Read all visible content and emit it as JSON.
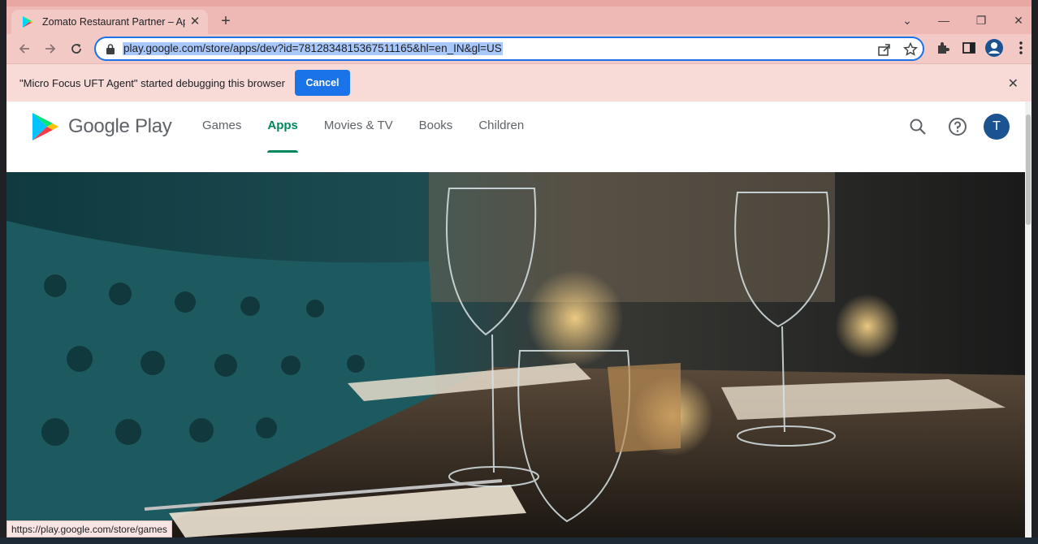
{
  "browser": {
    "tab_title": "Zomato Restaurant Partner – App",
    "new_tab_label": "+",
    "url": "play.google.com/store/apps/dev?id=7812834815367511165&hl=en_IN&gl=US",
    "infobar_text": "\"Micro Focus UFT Agent\" started debugging this browser",
    "cancel_label": "Cancel",
    "status_url": "https://play.google.com/store/games"
  },
  "play": {
    "logo_text": "Google Play",
    "nav": [
      {
        "label": "Games"
      },
      {
        "label": "Apps"
      },
      {
        "label": "Movies & TV"
      },
      {
        "label": "Books"
      },
      {
        "label": "Children"
      }
    ],
    "active_nav": "Apps",
    "avatar_letter": "T"
  },
  "colors": {
    "accent_green": "#01875f",
    "chrome_accent": "#1a73e8",
    "avatar_bg": "#1a5390"
  },
  "hero": {
    "icon": "restaurant-table-photo"
  }
}
